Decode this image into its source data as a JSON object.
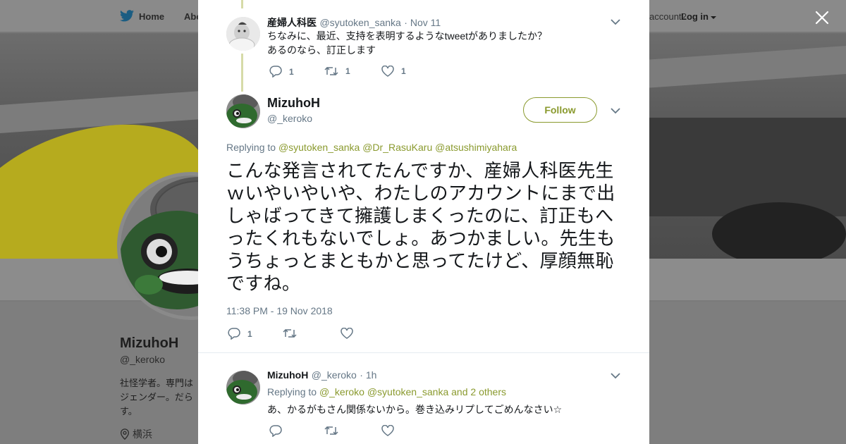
{
  "nav": {
    "home_label": "Home",
    "about_label": "Abo",
    "account_prompt": "account?",
    "login_label": "Log in"
  },
  "profile": {
    "name": "MizuhoH",
    "handle": "@_keroko",
    "bio": "社怪学者。専門は\nジェンダー。だら\nす。",
    "location": "横浜"
  },
  "tweets": [
    {
      "name": "産婦人科医",
      "handle": "@syutoken_sanka",
      "time": "· Nov 11",
      "line1": "ちなみに、最近、支持を表明するようなtweetがありましたか？",
      "line2": "あるのなら、訂正します",
      "replies": "1",
      "retweets": "1",
      "likes": "1"
    },
    {
      "name": "MizuhoH",
      "handle": "@_keroko",
      "follow_label": "Follow",
      "replying_prefix": "Replying to",
      "replying_links": "@syutoken_sanka @Dr_RasuKaru @atsushimiyahara",
      "text": "こんな発言されてたんですか、産婦人科医先生ｗいやいやいや、わたしのアカウントにまで出しゃばってきて擁護しまくったのに、訂正もへったくれもないでしょ。あつかましい。先生もうちょっとまともかと思ってたけど、厚顔無恥ですね。",
      "timestamp": "11:38 PM - 19 Nov 2018",
      "replies": "1"
    },
    {
      "name": "MizuhoH",
      "handle": "@_keroko",
      "time": "· 1h",
      "replying_prefix": "Replying to",
      "replying_links": "@_keroko @syutoken_sanka",
      "replying_suffix": "and 2 others",
      "text": "あ、かるがもさん関係ないから。巻き込みリプしてごめんなさい☆"
    }
  ],
  "colors": {
    "accent": "#8a9a2e",
    "thread_line": "#d6dba8",
    "muted": "#657786",
    "text": "#14171a"
  },
  "icons": [
    "twitter-bird-icon",
    "close-icon",
    "chevron-down-icon",
    "reply-icon",
    "retweet-icon",
    "heart-icon",
    "location-pin-icon"
  ]
}
